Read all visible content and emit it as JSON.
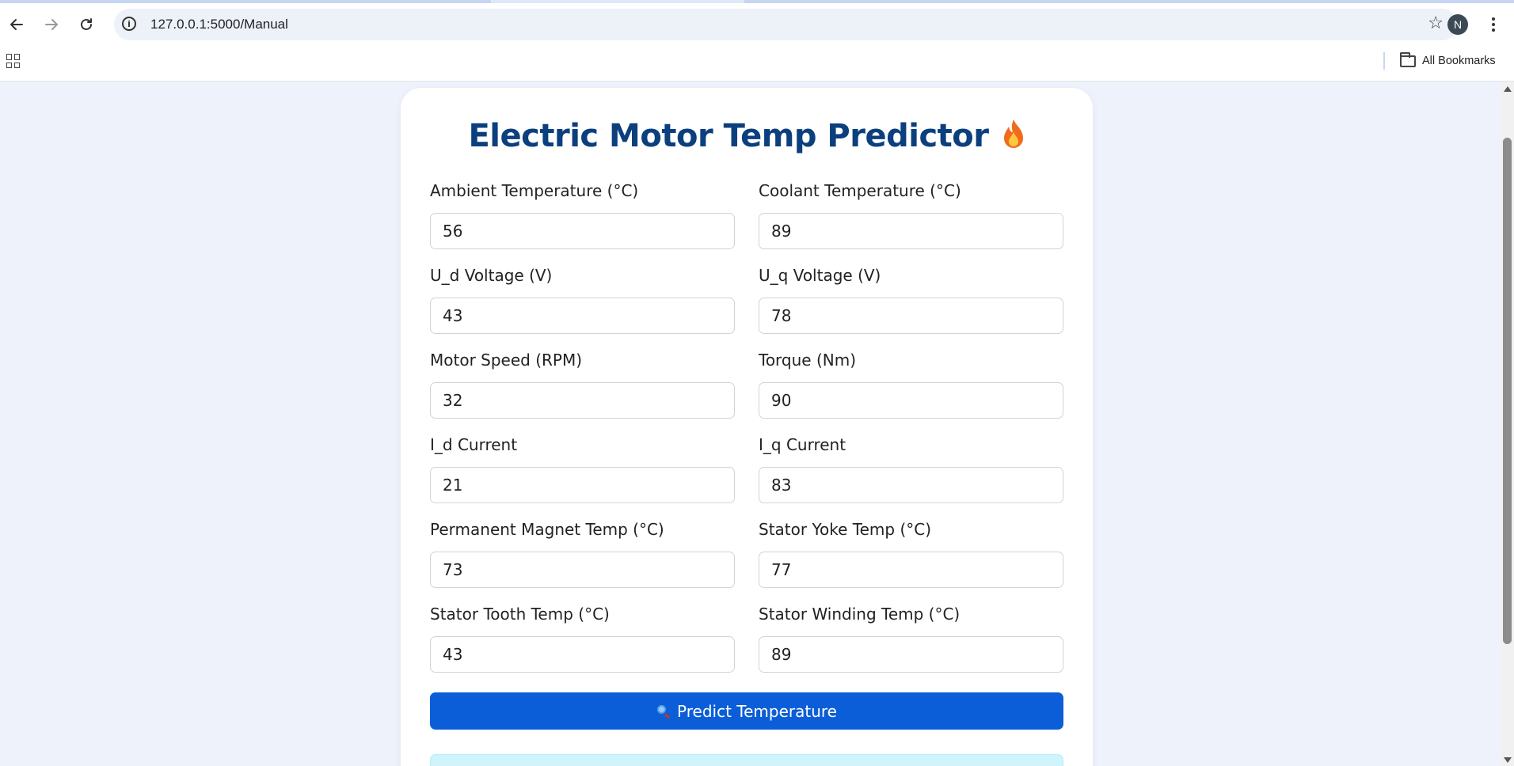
{
  "browser": {
    "url": "127.0.0.1:5000/Manual",
    "profile_initial": "N",
    "bookmarks_label": "All Bookmarks",
    "icons": {
      "back": "arrow-left-icon",
      "forward": "arrow-right-icon",
      "reload": "reload-icon",
      "site_info": "info-icon",
      "bookmark_star": "star-icon",
      "menu": "more-vert-icon",
      "apps": "apps-grid-icon",
      "folder": "folder-icon"
    }
  },
  "page": {
    "title": "Electric Motor Temp Predictor",
    "title_icon": "flame-icon",
    "title_color": "#0b3f7e",
    "fields": [
      {
        "label": "Ambient Temperature (°C)",
        "value": "56"
      },
      {
        "label": "Coolant Temperature (°C)",
        "value": "89"
      },
      {
        "label": "U_d Voltage (V)",
        "value": "43"
      },
      {
        "label": "U_q Voltage (V)",
        "value": "78"
      },
      {
        "label": "Motor Speed (RPM)",
        "value": "32"
      },
      {
        "label": "Torque (Nm)",
        "value": "90"
      },
      {
        "label": "I_d Current",
        "value": "21"
      },
      {
        "label": "I_q Current",
        "value": "83"
      },
      {
        "label": "Permanent Magnet Temp (°C)",
        "value": "73"
      },
      {
        "label": "Stator Yoke Temp (°C)",
        "value": "77"
      },
      {
        "label": "Stator Tooth Temp (°C)",
        "value": "43"
      },
      {
        "label": "Stator Winding Temp (°C)",
        "value": "89"
      }
    ],
    "predict_button": {
      "label": "Predict Temperature",
      "icon": "magnifier-icon",
      "color": "#0b5ed7"
    },
    "result_box_color": "#cff4fc"
  }
}
